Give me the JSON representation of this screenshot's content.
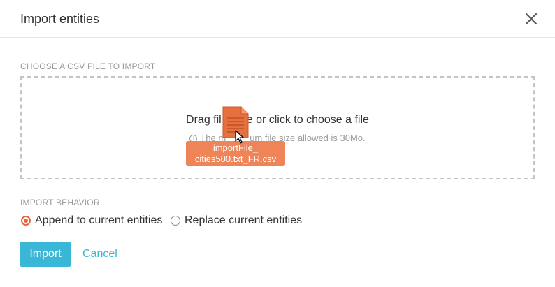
{
  "dialog": {
    "title": "Import entities"
  },
  "file_section": {
    "label": "CHOOSE A CSV FILE TO IMPORT",
    "drop_text_start": "Drag fil",
    "drop_text_end": "e or click to choose a file",
    "hint_start": "The m",
    "hint_end": "um file size allowed is 30Mo."
  },
  "drag_preview": {
    "file_name_line1": "importFile_",
    "file_name_line2": "cities500.txt_FR.csv"
  },
  "behavior_section": {
    "label": "IMPORT BEHAVIOR",
    "options": [
      {
        "label": "Append to current entities",
        "selected": true
      },
      {
        "label": "Replace current entities",
        "selected": false
      }
    ]
  },
  "actions": {
    "import_label": "Import",
    "cancel_label": "Cancel"
  },
  "colors": {
    "accent": "#e8653c",
    "primary": "#3ab6d6",
    "drag_badge": "#ef8459"
  },
  "icons": [
    "close-icon",
    "info-icon",
    "file-icon",
    "cursor-icon"
  ]
}
